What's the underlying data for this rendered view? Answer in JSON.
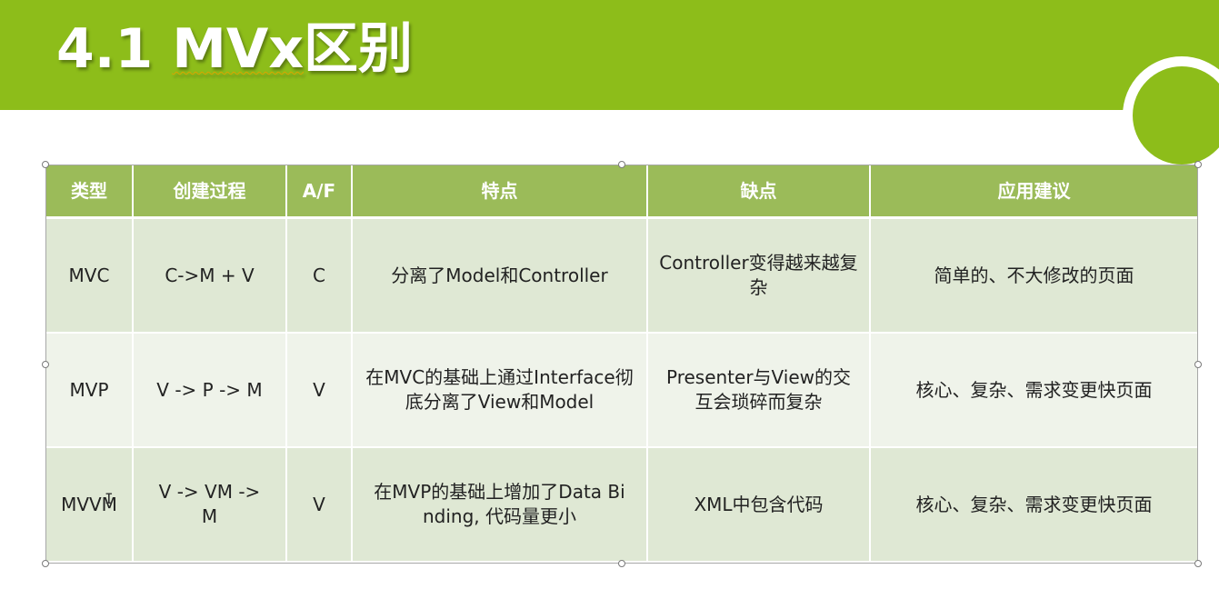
{
  "slide": {
    "title_prefix": "4.1 ",
    "title_underlined": "MVx",
    "title_suffix": "区别"
  },
  "table": {
    "headers": [
      "类型",
      "创建过程",
      "A/F",
      "特点",
      "缺点",
      "应用建议"
    ],
    "rows": [
      [
        "MVC",
        "C->M + V",
        "C",
        "分离了Model和Controller",
        "Controller变得越来越复杂",
        "简单的、不大修改的页面"
      ],
      [
        "MVP",
        "V -> P -> M",
        "V",
        "在MVC的基础上通过Interface彻底分离了View和Model",
        "Presenter与View的交互会琐碎而复杂",
        "核心、复杂、需求变更快页面"
      ],
      [
        "MVVM",
        "V -> VM -> M",
        "V",
        "在MVP的基础上增加了Data Binding, 代码量更小",
        "XML中包含代码",
        "核心、复杂、需求变更快页面"
      ]
    ]
  },
  "colors": {
    "title_bar": "#8dbd1a",
    "table_header": "#9bbb59",
    "row_dark": "#dfe8d4",
    "row_light": "#eff3ea"
  },
  "icons": {
    "text_cursor": "i-beam-cursor-icon"
  }
}
